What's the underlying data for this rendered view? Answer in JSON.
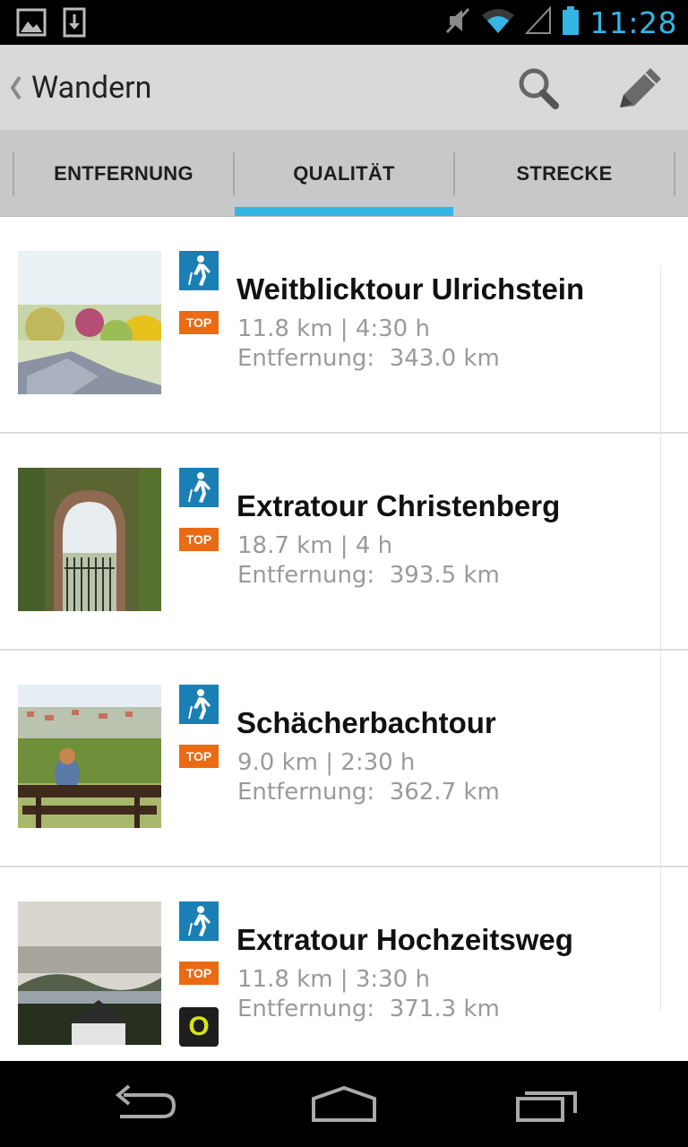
{
  "status_bar": {
    "time": "11:28",
    "left_icons": [
      "gallery-icon",
      "download-icon"
    ],
    "right_icons": [
      "mute-icon",
      "wifi-icon",
      "signal-icon",
      "battery-icon"
    ],
    "accent_color": "#33b5e5"
  },
  "action_bar": {
    "back_icon": "chevron-left-icon",
    "title": "Wandern",
    "actions": [
      "search-icon",
      "edit-pencil-icon"
    ]
  },
  "tabs": {
    "items": [
      {
        "label": "ENTFERNUNG"
      },
      {
        "label": "QUALITÄT"
      },
      {
        "label": "STRECKE"
      }
    ],
    "selected_index": 1,
    "indicator_color": "#33b5e5"
  },
  "tours": [
    {
      "title": "Weitblicktour Ulrichstein",
      "meta": "11.8 km | 4:30 h",
      "distance": "Entfernung:  343.0 km",
      "top_label": "TOP",
      "type_icon": "hiker-icon",
      "has_extra_badge": false
    },
    {
      "title": "Extratour Christenberg",
      "meta": "18.7 km | 4 h",
      "distance": "Entfernung:  393.5 km",
      "top_label": "TOP",
      "type_icon": "hiker-icon",
      "has_extra_badge": false
    },
    {
      "title": "Schächerbachtour",
      "meta": "9.0 km | 2:30 h",
      "distance": "Entfernung:  362.7 km",
      "top_label": "TOP",
      "type_icon": "hiker-icon",
      "has_extra_badge": false
    },
    {
      "title": "Extratour Hochzeitsweg",
      "meta": "11.8 km | 3:30 h",
      "distance": "Entfernung:  371.3 km",
      "top_label": "TOP",
      "type_icon": "hiker-icon",
      "has_extra_badge": true,
      "extra_badge_label": "O"
    }
  ],
  "nav_bar": {
    "buttons": [
      "back-arrow-icon",
      "home-icon",
      "recent-apps-icon"
    ]
  }
}
